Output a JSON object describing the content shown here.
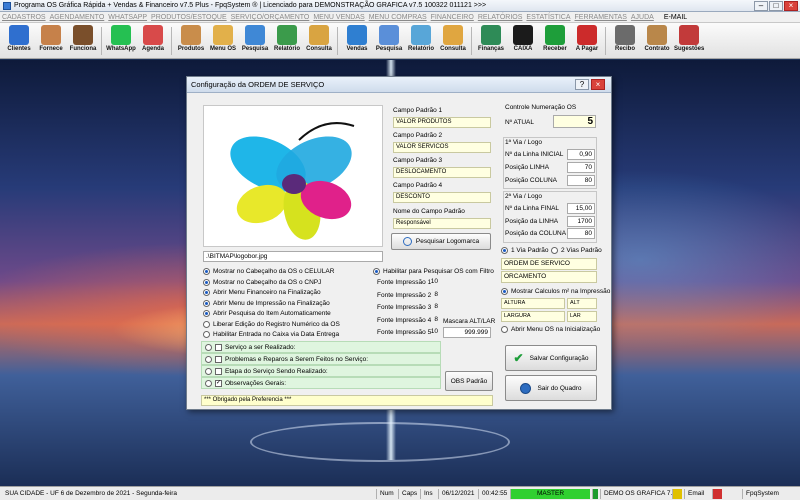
{
  "titlebar": {
    "title": "Programa OS Gráfica Rápida + Vendas & Financeiro v7.5 Plus - FpqSystem ® | Licenciado para  DEMONSTRAÇÃO GRAFICA v7.5 100322 011121 >>>"
  },
  "menu": [
    "CADASTROS",
    "AGENDAMENTO",
    "WHATSAPP",
    "PRODUTOS/ESTOQUE",
    "SERVIÇO/ORÇAMENTO",
    "MENU VENDAS",
    "MENU COMPRAS",
    "FINANCEIRO",
    "RELATÓRIOS",
    "ESTATÍSTICA",
    "FERRAMENTAS",
    "AJUDA",
    "E-MAIL"
  ],
  "toolbar": [
    "Clientes",
    "Fornece",
    "Funciona",
    "WhatsApp",
    "Agenda",
    "Produtos",
    "Menu OS",
    "Pesquisa",
    "Relatório",
    "Consulta",
    "Vendas",
    "Pesquisa",
    "Relatório",
    "Consulta",
    "Finanças",
    "CAIXA",
    "Receber",
    "A Pagar",
    "Recibo",
    "Contrato",
    "Sugestões"
  ],
  "colors": {
    "toolbar": [
      "#2f6fcf",
      "#c6814a",
      "#7a4f2b",
      "#25c052",
      "#d84a4a",
      "#c98d4b",
      "#e2b04a",
      "#3f88d6",
      "#3b9b4b",
      "#d9a441",
      "#2f7fd1",
      "#5a8fd9",
      "#58a6d8",
      "#e0a640",
      "#2e8b57",
      "#1b1b1b",
      "#1e9e3a",
      "#cc2b2b",
      "#6b6b6b",
      "#b9874a",
      "#c23a3a"
    ]
  },
  "dialog": {
    "title": "Configuração da ORDEM DE SERVIÇO",
    "logo_path": ".\\BITMAP\\logobor.jpg",
    "campo1": {
      "label": "Campo Padrão 1",
      "value": "VALOR PRODUTOS"
    },
    "campo2": {
      "label": "Campo Padrão 2",
      "value": "VALOR SERVICOS"
    },
    "campo3": {
      "label": "Campo Padrão 3",
      "value": "DESLOCAMENTO"
    },
    "campo4": {
      "label": "Campo Padrão 4",
      "value": "DESCONTO"
    },
    "nome_campo": {
      "label": "Nome do Campo Padrão",
      "value": "Responsável"
    },
    "pesquisar_logo": "Pesquisar Logomarca",
    "controle": "Controle Numeração OS",
    "n_atual_label": "Nº ATUAL",
    "n_atual": "5",
    "via1": {
      "title": "1ª Via / Logo",
      "l1": "Nº da Linha INICIAL",
      "v1": "0,90",
      "l2": "Posição LINHA",
      "v2": "70",
      "l3": "Posição COLUNA",
      "v3": "80"
    },
    "via2": {
      "title": "2ª Via / Logo",
      "l1": "Nº da Linha FINAL",
      "v1": "15,00",
      "l2": "Posição da LINHA",
      "v2": "1700",
      "l3": "Posição da COLUNA",
      "v3": "80"
    },
    "opt_1via": "1 Via Padrão",
    "opt_2vias": "2 Vias Padrão",
    "ordem": "ORDEM DE SERVICO",
    "orcamento": "ORCAMENTO",
    "mostrar_m2": "Mostrar Calculos m² na Impressão",
    "altura": "ALTURA",
    "alt": "ALT",
    "largura": "LARGURA",
    "lar": "LAR",
    "abrir_menu_os": "Abrir Menu OS na Inicialização",
    "opts": [
      "Mostrar no Cabeçalho da OS o CELULAR",
      "Mostrar no Cabeçalho da OS o CNPJ",
      "Abrir Menu Financeiro na Finalização",
      "Abrir Menu de Impressão na Finalização",
      "Abrir Pesquisa do Item Automaticamente",
      "Liberar Edição do Registro Numérico da OS",
      "Habilitar Entrada no Caixa via Data Entrega"
    ],
    "habilitar_filtro": "Habilitar para Pesquisar OS com Filtro",
    "fontes": [
      {
        "label": "Fonte Impressão 1",
        "value": "10"
      },
      {
        "label": "Fonte Impressão 2",
        "value": "8"
      },
      {
        "label": "Fonte Impressão 3",
        "value": "8"
      },
      {
        "label": "Fonte Impressão 4",
        "value": "8"
      },
      {
        "label": "Fonte Impressão 5",
        "value": "10"
      }
    ],
    "mascara_label": "Mascara ALT/LAR",
    "mascara_value": "999.999",
    "strips": [
      "Serviço a ser Realizado:",
      "Problemas e Reparos a Serem Feitos no Serviço:",
      "Etapa do Serviço Sendo Realizado:",
      "Observações Gerais:"
    ],
    "obs_padrao": "OBS Padrão",
    "obrigado": "*** Obrigado pela Preferencia ***",
    "salvar": "Salvar Configuração",
    "sair": "Sair do Quadro"
  },
  "status": {
    "city": "SUA CIDADE - UF  6 de Dezembro de 2021 - Segunda-feira",
    "num": "Num",
    "caps": "Caps",
    "ins": "Ins",
    "date": "06/12/2021",
    "time": "00:42:55",
    "master": "MASTER",
    "demo": "DEMO OS GRAFICA 7.5",
    "email": "Email",
    "brand": "FpqSystem"
  }
}
